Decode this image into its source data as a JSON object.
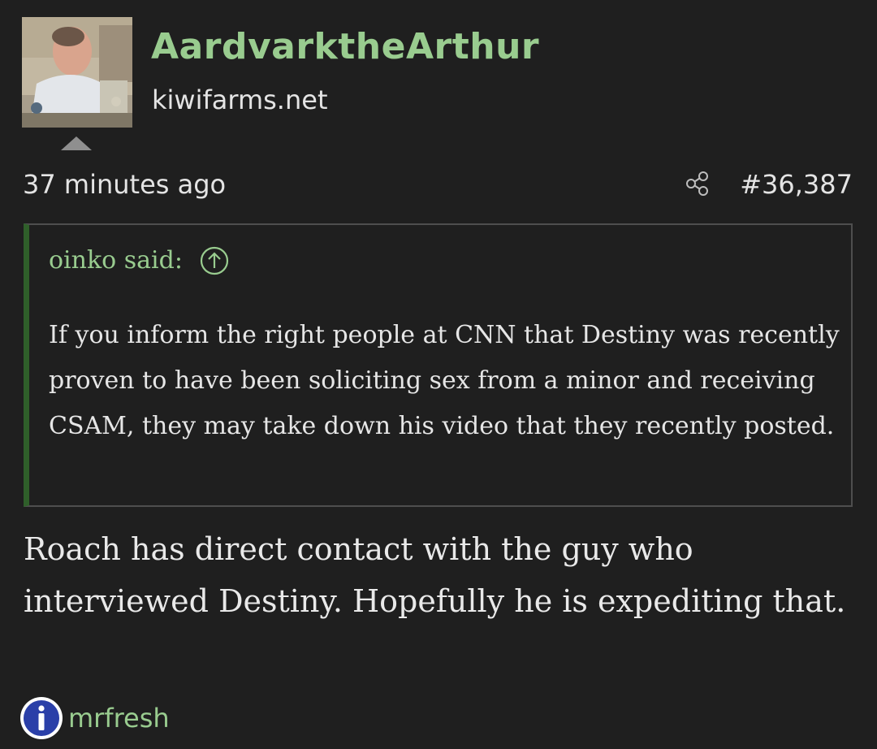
{
  "post": {
    "author": {
      "username": "AardvarktheArthur",
      "site": "kiwifarms.net",
      "avatar_alt": "user-avatar"
    },
    "timestamp": "37 minutes ago",
    "post_number": "#36,387",
    "share_icon": "share-icon",
    "quote": {
      "attribution": "oinko said:",
      "jump_icon": "arrow-up-circle-icon",
      "text": "If you inform the right people at CNN that Destiny was recently proven to have been soliciting sex from a minor and receiving CSAM, they may take down his video that they recently posted."
    },
    "body": "Roach has direct contact with the guy who interviewed Destiny. Hopefully he is expediting that."
  },
  "footer": {
    "username": "mrfresh",
    "icon": "info-icon"
  },
  "colors": {
    "background": "#1f1f1f",
    "username_green": "#99cc8f",
    "quote_bar": "#2f5f2a",
    "quote_border": "#4e4e4e",
    "text": "#e6e6e6"
  }
}
